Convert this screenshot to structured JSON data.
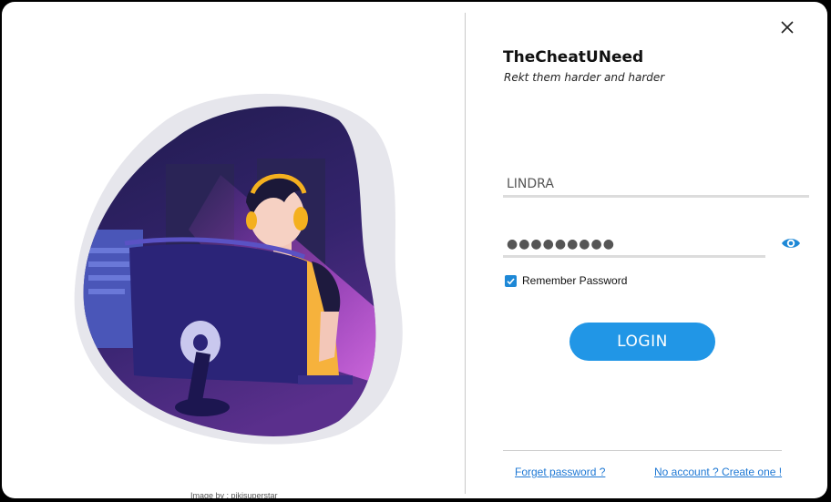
{
  "app": {
    "title": "TheCheatUNeed",
    "tagline": "Rekt them harder and harder"
  },
  "illustration": {
    "credit": "Image by : pikisuperstar"
  },
  "form": {
    "username_value": "LINDRA",
    "password_value": "●●●●●●●●●",
    "remember_label": "Remember Password",
    "remember_checked": true,
    "login_label": "LOGIN"
  },
  "footer": {
    "forgot_label": "Forget password ?",
    "create_label": "No account ? Create one !"
  },
  "colors": {
    "accent": "#2196e6",
    "link": "#1e78d4",
    "illustration_bg": "#2a2060"
  },
  "icons": [
    "close-icon",
    "eye-icon",
    "checkmark-icon"
  ]
}
